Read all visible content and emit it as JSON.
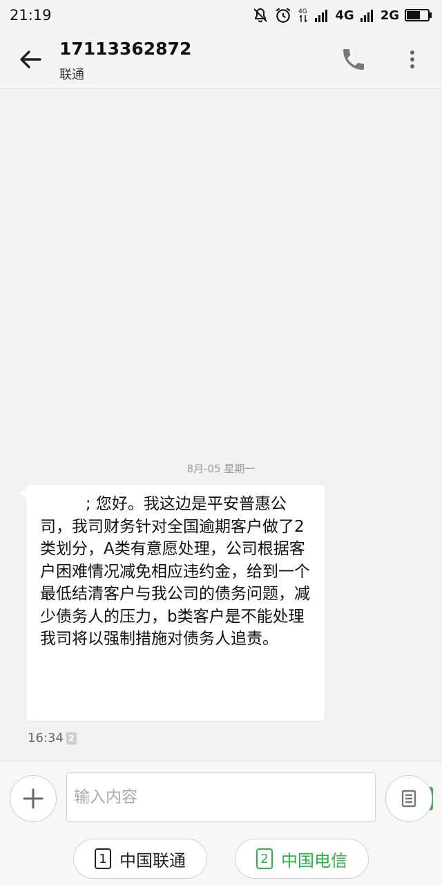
{
  "status_bar": {
    "time": "21:19",
    "network_1": "4G",
    "network_2": "2G",
    "icons": [
      "bell-off-icon",
      "alarm-icon",
      "data-4g-icon",
      "signal-icon",
      "signal-icon",
      "battery-icon"
    ],
    "battery_level": 0.62
  },
  "header": {
    "contact_number": "17113362872",
    "carrier": "联通",
    "icons": [
      "back-arrow-icon",
      "phone-icon",
      "more-vert-icon"
    ]
  },
  "conversation": {
    "date_separator": "8月-05  星期一",
    "message": {
      "text": "         ; 您好。我这边是平安普惠公司，我司财务针对全国逾期客户做了2类划分，A类有意愿处理，公司根据客户困难情况减免相应违约金，给到一个最低结清客户与我公司的债务问题，减少债务人的压力，b类客户是不能处理我司将以强制措施对债务人追责。",
      "time": "16:34",
      "sim_badge": "2"
    }
  },
  "composer": {
    "placeholder": "输入内容",
    "value": "",
    "sim_selected": "2",
    "icons": [
      "plus-icon",
      "template-icon"
    ]
  },
  "sim_buttons": [
    {
      "num": "1",
      "label": "中国联通"
    },
    {
      "num": "2",
      "label": "中国电信"
    }
  ],
  "colors": {
    "accent_green": "#2db24a",
    "background": "#f2f2f2"
  }
}
